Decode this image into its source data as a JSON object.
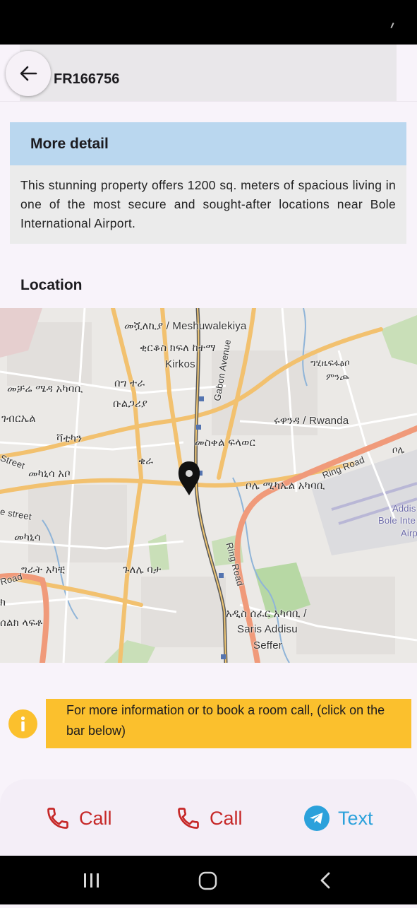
{
  "listing": {
    "id_text": "D FR166756"
  },
  "detail": {
    "title": "More detail",
    "description": "This stunning property offers 1200 sq. meters of spacious living in one of the most secure and sought-after locations near Bole International Airport."
  },
  "location": {
    "title": "Location",
    "map_labels": [
      "መሿለኪያ / Meshuwalekiya",
      "ቂርቆስ ክፍለ ከተማ",
      "Kirkos",
      "መቻሬ ሜዳ አካባቢ",
      "በግ ተራ",
      "ቡልጋሪያ",
      "ገብርኤል",
      "ቫቲካን",
      "ቄራ",
      "መካኒሳ አቦ",
      "መስቀል ፍላወር",
      "ሩዋንዳ / Rwanda",
      "ቦሌ ሚካኤል አካባቢ",
      "ግሂዜፍፋፅቦ",
      "ምንጮ",
      "ቦሌ",
      "Ring Road",
      "Gabon Avenue",
      "Addis",
      "Bole Inte",
      "Airp",
      "መካኒሳ",
      "ግራት አካቺ",
      "ጉለሌ ባታ",
      "ሰልክ ላፍቶ",
      "አዲስ ሰፈር አካባቢ /",
      "Saris Addisu",
      "Seffer",
      "Ring Road",
      "Street",
      "e street",
      "Road",
      "ክ"
    ]
  },
  "info": {
    "message": "For more information or to book a room call, (click on the bar below)"
  },
  "actions": {
    "call1_label": "Call",
    "call2_label": "Call",
    "text_label": "Text"
  },
  "colors": {
    "call": "#c62828",
    "telegram": "#2ba1db",
    "banner": "#fbc02d",
    "detail_header": "#bad7ef"
  }
}
